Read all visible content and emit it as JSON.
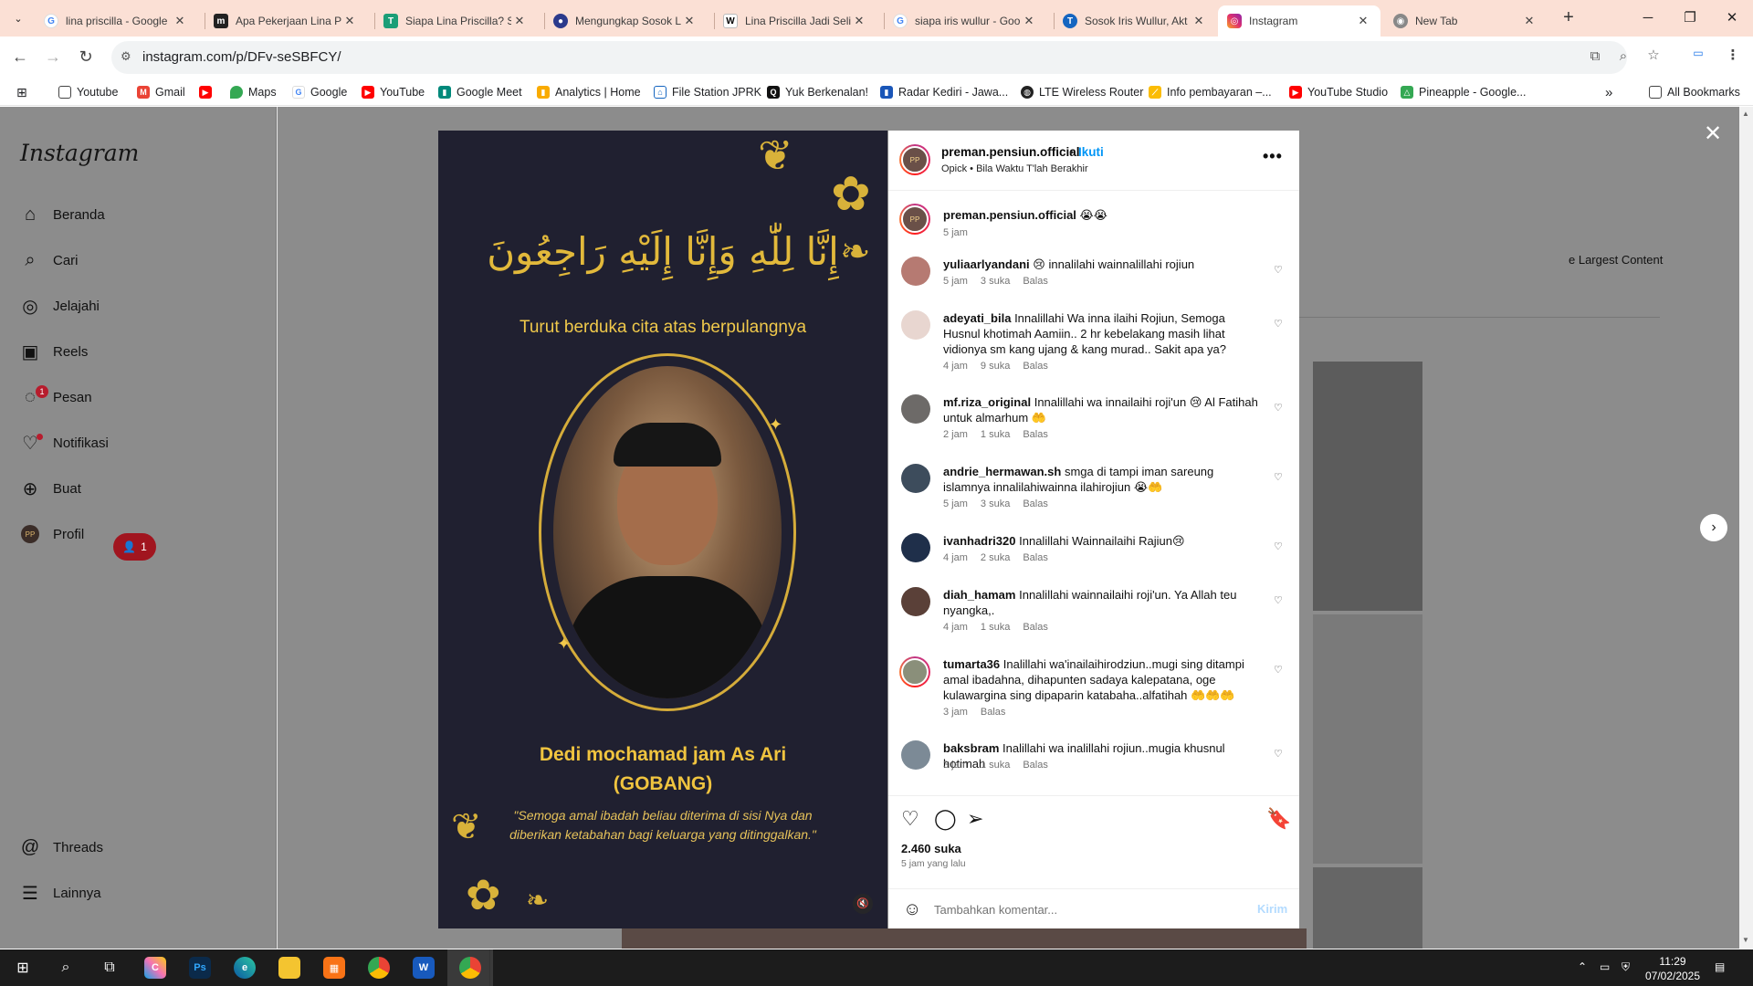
{
  "tabs": [
    {
      "title": "lina priscilla - Google",
      "favicon": "google-icon",
      "active": false
    },
    {
      "title": "Apa Pekerjaan Lina P",
      "favicon": "news-icon",
      "active": false
    },
    {
      "title": "Siapa Lina Priscilla? S",
      "favicon": "news-icon",
      "active": false
    },
    {
      "title": "Mengungkap Sosok L",
      "favicon": "news-icon",
      "active": false
    },
    {
      "title": "Lina Priscilla Jadi Seli",
      "favicon": "news-icon",
      "active": false
    },
    {
      "title": "siapa iris wullur - Goo",
      "favicon": "google-icon",
      "active": false
    },
    {
      "title": "Sosok Iris Wullur, Akt",
      "favicon": "news-icon",
      "active": false
    },
    {
      "title": "Instagram",
      "favicon": "instagram-icon",
      "active": true
    },
    {
      "title": "New Tab",
      "favicon": "chrome-icon",
      "active": false
    }
  ],
  "address": {
    "url": "instagram.com/p/DFv-seSBFCY/"
  },
  "bookmarks": [
    "Youtube",
    "Gmail",
    "",
    "Maps",
    "Google",
    "YouTube",
    "Google Meet",
    "Analytics | Home",
    "File Station JPRK",
    "Yuk Berkenalan!",
    "Radar Kediri - Jawa...",
    "LTE Wireless Router",
    "Info pembayaran –...",
    "YouTube Studio",
    "Pineapple - Google..."
  ],
  "bookmarks_overflow": "»",
  "all_bookmarks": "All Bookmarks",
  "instagram": {
    "logo": "Instagram",
    "nav": [
      {
        "label": "Beranda",
        "icon": "home-icon"
      },
      {
        "label": "Cari",
        "icon": "search-icon"
      },
      {
        "label": "Jelajahi",
        "icon": "compass-icon"
      },
      {
        "label": "Reels",
        "icon": "reels-icon"
      },
      {
        "label": "Pesan",
        "icon": "messenger-icon",
        "badge": "1"
      },
      {
        "label": "Notifikasi",
        "icon": "heart-icon"
      },
      {
        "label": "Buat",
        "icon": "plus-square-icon"
      },
      {
        "label": "Profil",
        "icon": "avatar"
      }
    ],
    "notif_pill": "1",
    "bottom_nav": [
      {
        "label": "Threads",
        "icon": "threads-icon"
      },
      {
        "label": "Lainnya",
        "icon": "menu-icon"
      }
    ],
    "background_label": "e Largest Content"
  },
  "media": {
    "arabic": "إِنَّا لِلّٰهِ وَإِنَّا إِلَيْهِ رَاجِعُونَ",
    "condolence": "Turut berduka cita atas berpulangnya",
    "name_line1": "Dedi mochamad jam As Ari",
    "name_line2": "(GOBANG)",
    "quote": "\"Semoga amal ibadah beliau diterima di sisi Nya dan diberikan ketabahan bagi keluarga yang ditinggalkan.\""
  },
  "post": {
    "username": "preman.pensiun.official",
    "dot": "•",
    "follow": "Ikuti",
    "audio": "Opick • Bila Waktu T'lah Berakhir",
    "caption_user": "preman.pensiun.official",
    "caption_text": "😭😭",
    "caption_time": "5 jam",
    "likes": "2.460 suka",
    "time_ago": "5 jam yang lalu",
    "comment_placeholder": "Tambahkan komentar...",
    "send_label": "Kirim"
  },
  "comments": [
    {
      "user": "yuliaarlyandani",
      "text": "😢 innalilahi wainnalillahi rojiun",
      "time": "5 jam",
      "likes": "3 suka",
      "reply": "Balas"
    },
    {
      "user": "adeyati_bila",
      "text": "Innalillahi Wa inna ilaihi Rojiun, Semoga Husnul khotimah Aamiin.. 2 hr kebelakang masih lihat vidionya sm kang ujang & kang murad.. Sakit apa ya?",
      "time": "4 jam",
      "likes": "9 suka",
      "reply": "Balas"
    },
    {
      "user": "mf.riza_original",
      "text": "Innalillahi wa innailaihi roji'un 😢 Al Fatihah untuk almarhum 🤲",
      "time": "2 jam",
      "likes": "1 suka",
      "reply": "Balas"
    },
    {
      "user": "andrie_hermawan.sh",
      "text": "smga di tampi iman sareung islamnya innalilahiwainna ilahirojiun 😭🤲",
      "time": "5 jam",
      "likes": "3 suka",
      "reply": "Balas"
    },
    {
      "user": "ivanhadri320",
      "text": "Innalillahi Wainnailaihi Rajiun😢",
      "time": "4 jam",
      "likes": "2 suka",
      "reply": "Balas"
    },
    {
      "user": "diah_hamam",
      "text": "Innalillahi wainnailaihi roji'un. Ya Allah teu nyangka,.",
      "time": "4 jam",
      "likes": "1 suka",
      "reply": "Balas"
    },
    {
      "user": "tumarta36",
      "text": "Inalillahi wa'inailaihirodziun..mugi sing ditampi amal ibadahna, dihapunten sadaya kalepatana, oge kulawargina sing dipaparin katabaha..alfatihah 🤲🤲🤲",
      "time": "3 jam",
      "likes": "",
      "reply": "Balas"
    },
    {
      "user": "baksbram",
      "text": "Inalillahi wa inalillahi rojiun..mugia khusnul hotimah",
      "time": "3 jam",
      "likes": "1 suka",
      "reply": "Balas"
    }
  ],
  "taskbar": {
    "time": "11:29",
    "date": "07/02/2025"
  }
}
